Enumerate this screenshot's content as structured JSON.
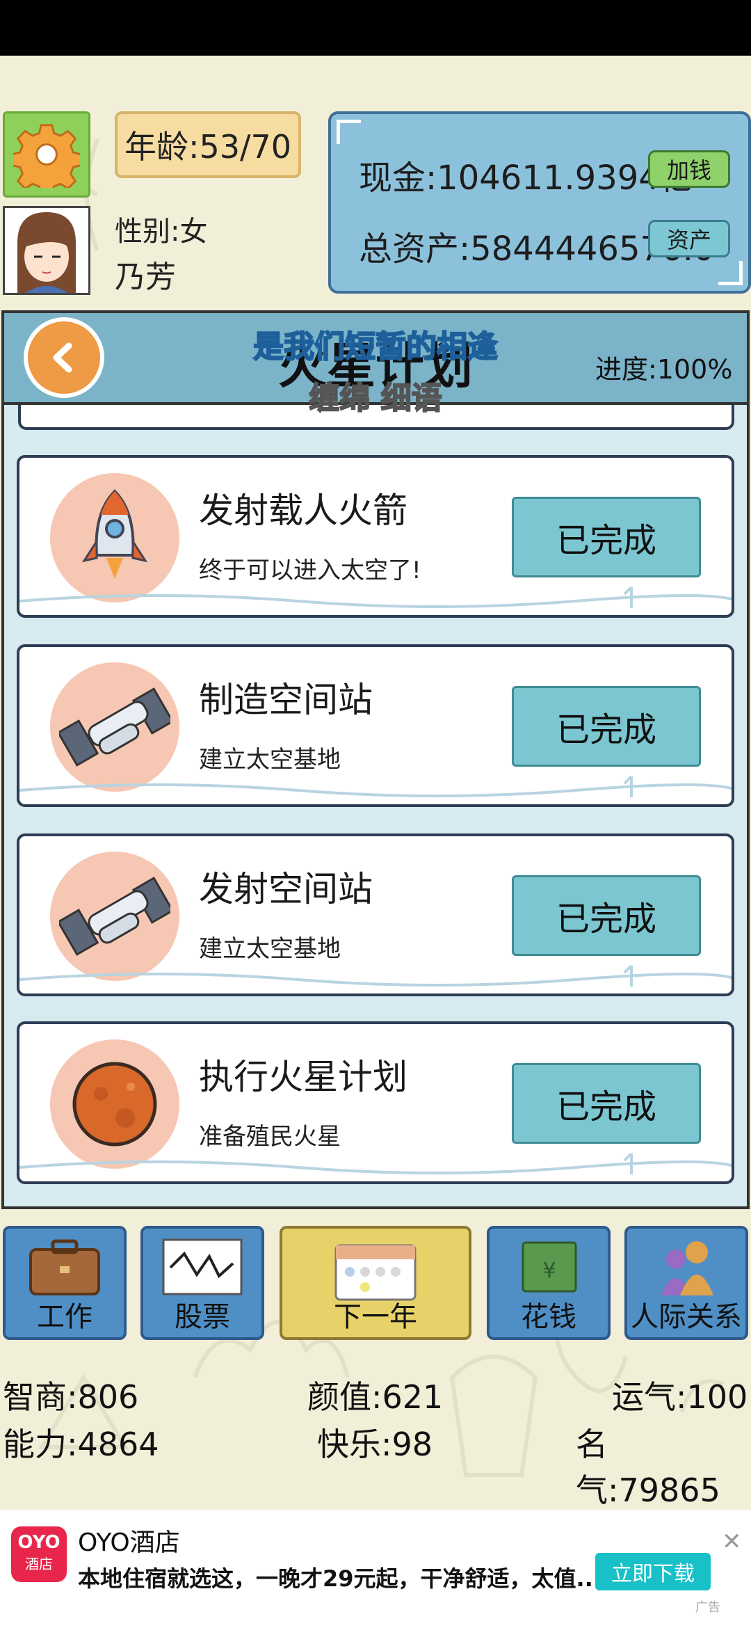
{
  "header": {
    "age": "年龄:53/70",
    "gender": "性别:女",
    "name": "乃芳",
    "cash": "现金:104611.9394亿",
    "assets": "总资产:5844446576.0",
    "add_money_label": "加钱",
    "assets_label": "资产"
  },
  "panel": {
    "title": "火星计划",
    "progress": "进度:100%",
    "lyric_line1": "是我们短暂的相逢",
    "lyric_line2": "缠绵 细语",
    "tasks": [
      {
        "title": "发射载人火箭",
        "desc": "终于可以进入太空了!",
        "status": "已完成",
        "icon": "rocket-icon"
      },
      {
        "title": "制造空间站",
        "desc": "建立太空基地",
        "status": "已完成",
        "icon": "space-station-icon"
      },
      {
        "title": "发射空间站",
        "desc": "建立太空基地",
        "status": "已完成",
        "icon": "space-station-icon"
      },
      {
        "title": "执行火星计划",
        "desc": "准备殖民火星",
        "status": "已完成",
        "icon": "mars-icon"
      }
    ]
  },
  "nav": {
    "work": "工作",
    "stocks": "股票",
    "next_year": "下一年",
    "spend": "花钱",
    "relations": "人际关系"
  },
  "stats": {
    "iq": "智商:806",
    "looks": "颜值:621",
    "luck": "运气:100",
    "ability": "能力:4864",
    "happiness": "快乐:98",
    "fame": "名气:79865"
  },
  "ad": {
    "logo_top": "OYO",
    "logo_bottom": "酒店",
    "title": "OYO酒店",
    "desc": "本地住宿就选这，一晚才29元起，干净舒适，太值...",
    "button": "立即下载",
    "close": "✕",
    "tag": "广告"
  },
  "colors": {
    "background": "#f1efd8",
    "panel_header": "#7bb3c9",
    "done_button": "#7bc6d0",
    "money_box": "#8cc1dc",
    "nav_button": "#4f8fc6",
    "ad_button": "#18c0c7"
  }
}
